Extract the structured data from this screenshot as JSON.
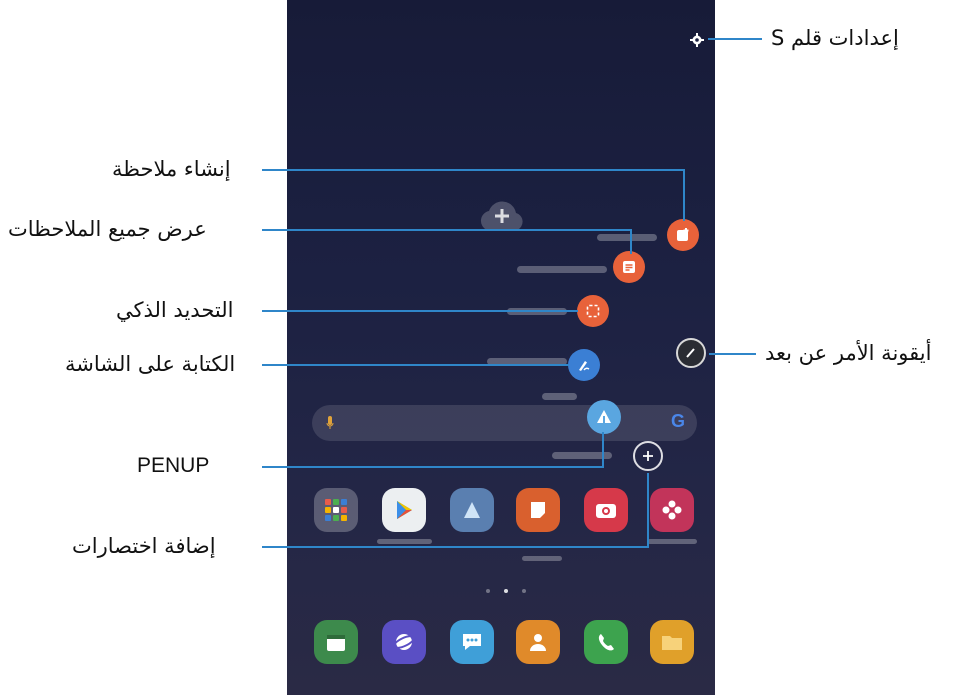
{
  "callouts": {
    "settings": "إعدادات قلم S",
    "create_note": "إنشاء ملاحظة",
    "view_all_notes": "عرض جميع الملاحظات",
    "smart_select": "التحديد الذكي",
    "screen_write": "الكتابة على الشاشة",
    "penup": "PENUP",
    "add_shortcuts": "إضافة اختصارات",
    "air_command_icon": "أيقونة الأمر عن بعد"
  },
  "search_bar": {
    "google_glyph": "G"
  },
  "colors": {
    "callout_line": "#2f86c9",
    "action_orange": "#e8623a",
    "action_blue": "#3b7fd4",
    "penup_blue": "#5aa6e0",
    "screen_bg": "#1c2142"
  },
  "icons": [
    "gear-icon",
    "note-add-icon",
    "notes-list-icon",
    "smart-select-icon",
    "pen-write-icon",
    "penup-icon",
    "plus-icon",
    "pen-icon",
    "mic-icon"
  ]
}
